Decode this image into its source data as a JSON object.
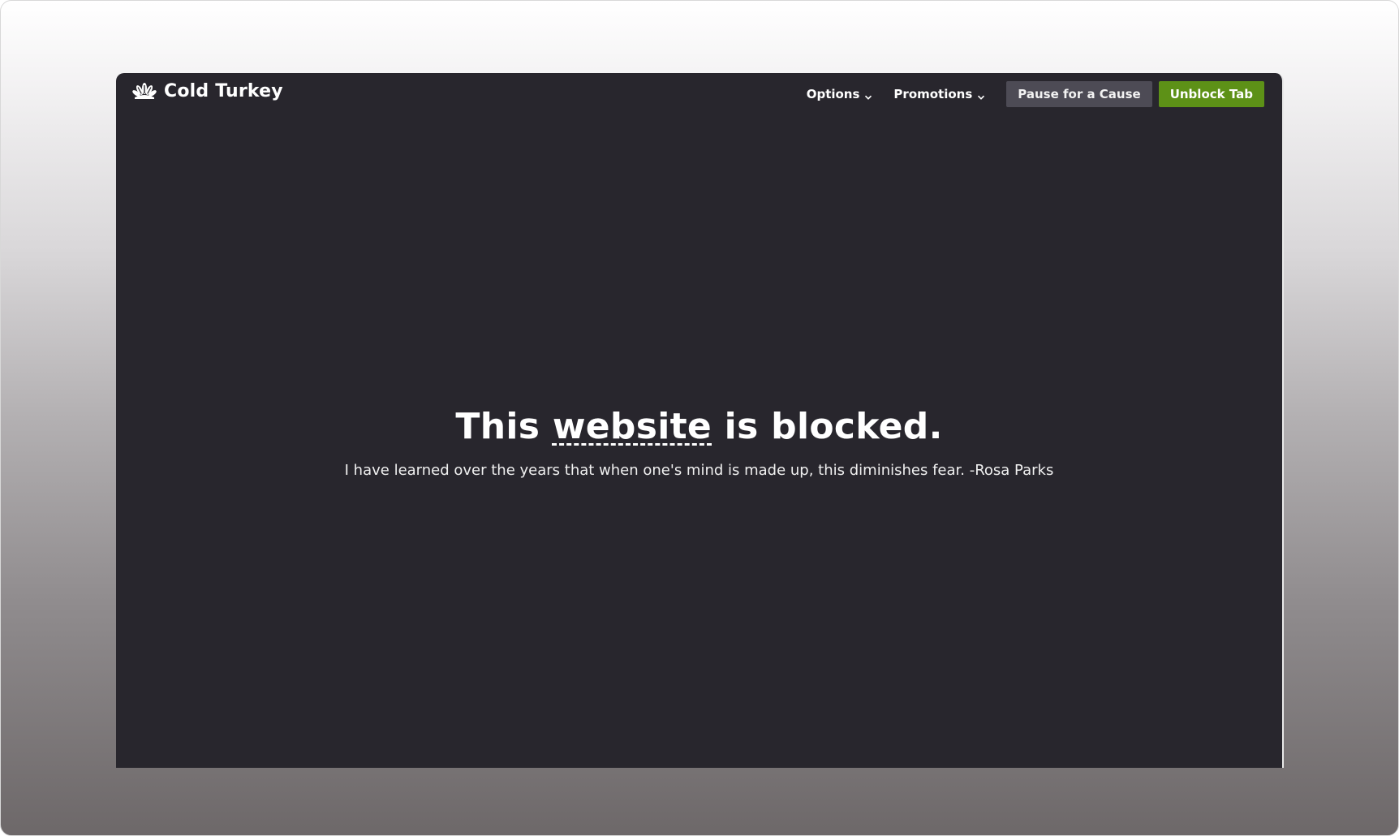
{
  "app": {
    "brand_name": "Cold Turkey",
    "logo_icon": "turkey-logo-icon"
  },
  "nav": {
    "options_label": "Options",
    "promotions_label": "Promotions",
    "pause_label": "Pause for a Cause",
    "unblock_label": "Unblock Tab"
  },
  "main": {
    "headline_before": "This ",
    "headline_word": "website",
    "headline_after": " is blocked.",
    "quote": "I have learned over the years that when one's mind is made up, this diminishes fear. -Rosa Parks"
  },
  "colors": {
    "window_bg": "#28262d",
    "pause_button_bg": "#4d4b55",
    "unblock_button_bg": "#5d9117",
    "text": "#ffffff"
  }
}
